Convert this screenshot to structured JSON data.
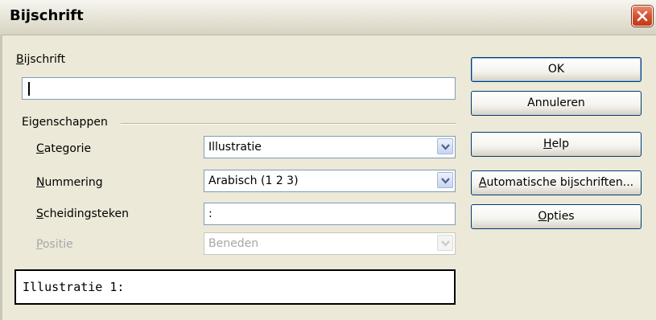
{
  "window": {
    "title": "Bijschrift"
  },
  "caption": {
    "label": "Bijschrift",
    "value": ""
  },
  "properties": {
    "heading": "Eigenschappen",
    "category": {
      "label": "Categorie",
      "value": "Illustratie"
    },
    "numbering": {
      "label": "Nummering",
      "value": "Arabisch (1 2 3)"
    },
    "separator": {
      "label": "Scheidingsteken",
      "value": ":"
    },
    "position": {
      "label": "Positie",
      "value": "Beneden",
      "disabled": true
    }
  },
  "preview": {
    "text": "Illustratie 1:"
  },
  "buttons": {
    "ok": "OK",
    "cancel": "Annuleren",
    "help": "Help",
    "auto_caption": "Automatische bijschriften...",
    "options": "Opties"
  },
  "icons": {
    "close": "close-icon",
    "dropdown": "chevron-down-icon"
  },
  "colors": {
    "close_button": "#d5512f",
    "field_border": "#7f9db9",
    "dialog_bg": "#ece9d8"
  }
}
